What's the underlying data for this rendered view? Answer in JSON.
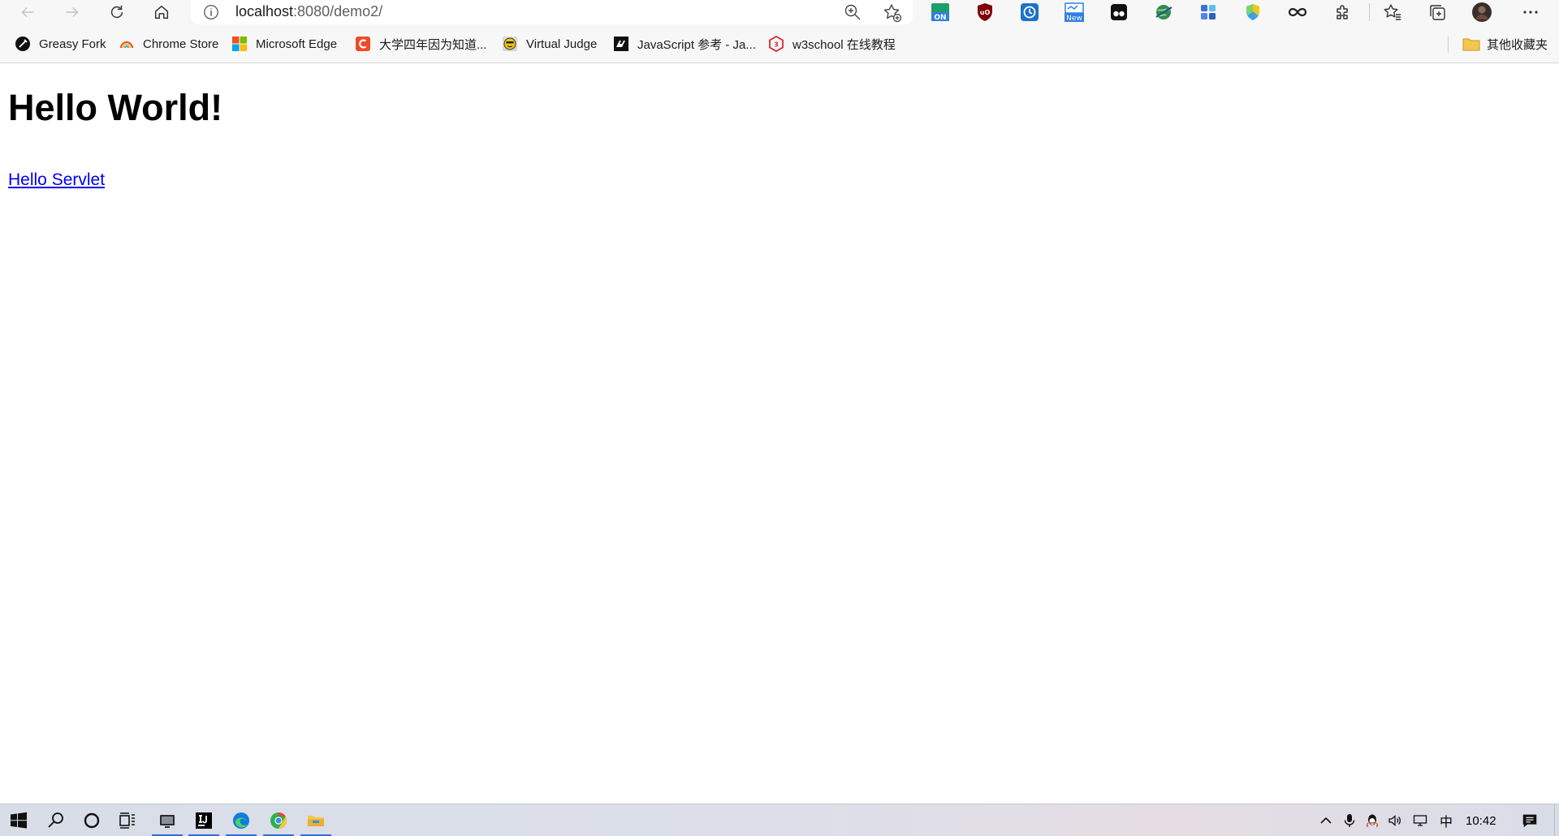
{
  "browser": {
    "url_host": "localhost",
    "url_path": ":8080/demo2/",
    "bookmarks": [
      {
        "label": "Greasy Fork"
      },
      {
        "label": "Chrome Store"
      },
      {
        "label": "Microsoft Edge"
      },
      {
        "label": "大学四年因为知道..."
      },
      {
        "label": "Virtual Judge"
      },
      {
        "label": "JavaScript 参考 - Ja..."
      },
      {
        "label": "w3school 在线教程"
      }
    ],
    "other_favorites": "其他收藏夹",
    "extension_badges": {
      "on": "ON",
      "new": "New"
    }
  },
  "page": {
    "heading": "Hello World!",
    "link": "Hello Servlet"
  },
  "taskbar": {
    "ime": "中",
    "time": "10:42"
  },
  "colors": {
    "link": "#0000ee",
    "accent": "#2e6fd6",
    "toolbar_bg": "#f7f7f7"
  }
}
